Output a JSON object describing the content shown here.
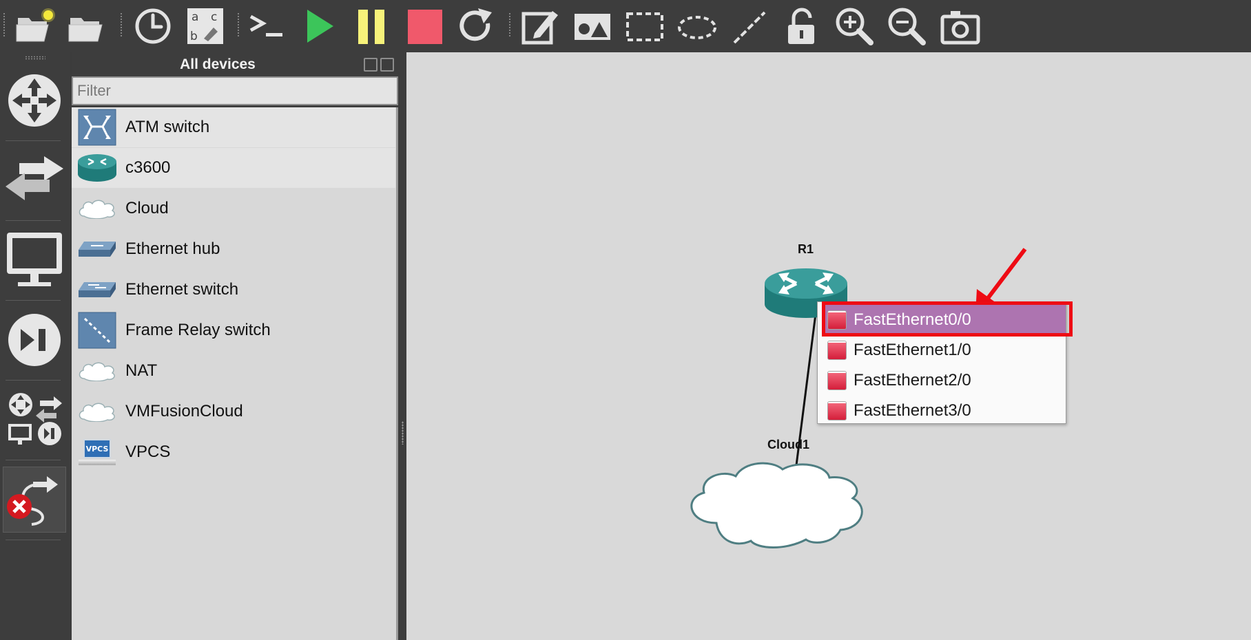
{
  "toolbar": {
    "buttons": [
      {
        "name": "new-project-button",
        "icon": "folder-new-icon"
      },
      {
        "name": "open-project-button",
        "icon": "folder-open-icon"
      },
      {
        "name": "snapshot-button",
        "icon": "clock-icon"
      },
      {
        "name": "show-interface-labels-button",
        "icon": "abc-label-icon"
      },
      {
        "name": "console-all-button",
        "icon": "terminal-icon"
      },
      {
        "name": "start-all-button",
        "icon": "play-icon"
      },
      {
        "name": "suspend-all-button",
        "icon": "pause-icon"
      },
      {
        "name": "stop-all-button",
        "icon": "stop-icon"
      },
      {
        "name": "reload-all-button",
        "icon": "reload-icon"
      },
      {
        "name": "add-note-button",
        "icon": "edit-note-icon"
      },
      {
        "name": "insert-picture-button",
        "icon": "picture-icon"
      },
      {
        "name": "draw-rectangle-button",
        "icon": "rectangle-icon"
      },
      {
        "name": "draw-ellipse-button",
        "icon": "ellipse-icon"
      },
      {
        "name": "draw-line-button",
        "icon": "line-icon"
      },
      {
        "name": "lock-items-button",
        "icon": "unlock-icon"
      },
      {
        "name": "zoom-in-button",
        "icon": "zoom-in-icon"
      },
      {
        "name": "zoom-out-button",
        "icon": "zoom-out-icon"
      },
      {
        "name": "screenshot-button",
        "icon": "camera-icon"
      }
    ],
    "colors": {
      "play": "#3cc55a",
      "pause": "#f7f27a",
      "stop": "#f0596b"
    }
  },
  "sidebar": {
    "buttons": [
      {
        "name": "browse-routers-button",
        "icon": "router-arrows-icon"
      },
      {
        "name": "browse-switches-button",
        "icon": "switch-arrows-icon"
      },
      {
        "name": "browse-end-devices-button",
        "icon": "monitor-icon"
      },
      {
        "name": "browse-security-devices-button",
        "icon": "play-pause-icon"
      },
      {
        "name": "browse-all-devices-button",
        "icon": "all-devices-icon"
      },
      {
        "name": "add-link-button",
        "icon": "add-link-cancel-icon"
      }
    ]
  },
  "dock": {
    "title": "All devices",
    "filter_placeholder": "Filter",
    "devices": [
      {
        "label": "ATM switch",
        "icon": "atm-switch-icon"
      },
      {
        "label": "c3600",
        "icon": "router-icon"
      },
      {
        "label": "Cloud",
        "icon": "cloud-icon"
      },
      {
        "label": "Ethernet hub",
        "icon": "ethernet-hub-icon"
      },
      {
        "label": "Ethernet switch",
        "icon": "ethernet-switch-icon"
      },
      {
        "label": "Frame Relay switch",
        "icon": "frame-relay-switch-icon"
      },
      {
        "label": "NAT",
        "icon": "cloud-icon"
      },
      {
        "label": "VMFusionCloud",
        "icon": "cloud-icon"
      },
      {
        "label": "VPCS",
        "icon": "vpcs-icon"
      }
    ],
    "vpcs_badge": "VPCS"
  },
  "canvas": {
    "router_label": "R1",
    "cloud_label": "Cloud1",
    "router_color": "#2c8a88",
    "cloud_stroke": "#4f7e82"
  },
  "port_menu": {
    "items": [
      {
        "label": "FastEthernet0/0",
        "active": true
      },
      {
        "label": "FastEthernet1/0",
        "active": false
      },
      {
        "label": "FastEthernet2/0",
        "active": false
      },
      {
        "label": "FastEthernet3/0",
        "active": false
      }
    ],
    "highlight_color": "#ee0b14",
    "active_color": "#ad74b0"
  }
}
